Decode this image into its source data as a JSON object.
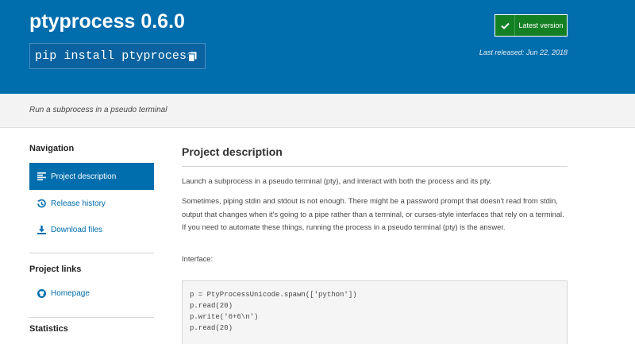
{
  "header": {
    "package_title": "ptyprocess 0.6.0",
    "pip_command": "pip install ptyprocess",
    "copy_icon": "copy-icon",
    "latest_badge_label": "Latest version",
    "latest_badge_icon": "check-icon",
    "last_released": "Last released: Jun 22, 2018",
    "banner_color": "#006dad",
    "badge_color": "#148024"
  },
  "summary": "Run a subprocess in a pseudo terminal",
  "sidebar": {
    "navigation_heading": "Navigation",
    "nav_items": [
      {
        "label": "Project description",
        "icon": "align-left-icon",
        "active": true
      },
      {
        "label": "Release history",
        "icon": "history-icon",
        "active": false
      },
      {
        "label": "Download files",
        "icon": "download-icon",
        "active": false
      }
    ],
    "project_links_heading": "Project links",
    "links": [
      {
        "label": "Homepage",
        "icon": "github-icon"
      }
    ],
    "statistics_heading": "Statistics"
  },
  "main": {
    "heading": "Project description",
    "paragraphs": [
      "Launch a subprocess in a pseudo terminal (pty), and interact with both the process and its pty.",
      "Sometimes, piping stdin and stdout is not enough. There might be a password prompt that doesn't read from stdin, output that changes when it's going to a pipe rather than a terminal, or curses-style interfaces that rely on a terminal. If you need to automate these things, running the process in a pseudo terminal (pty) is the answer.",
      "Interface:"
    ],
    "code_lines": [
      "p = PtyProcessUnicode.spawn(['python'])",
      "p.read(20)",
      "p.write('6+6\\n')",
      "p.read(20)"
    ]
  }
}
